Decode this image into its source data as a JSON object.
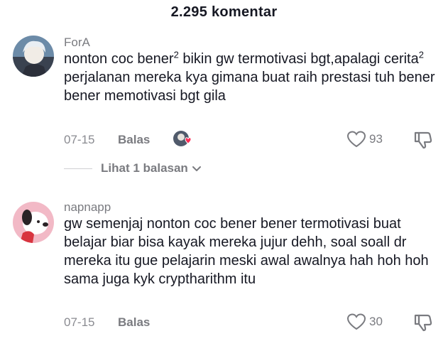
{
  "header": {
    "title": "2.295 komentar"
  },
  "comments": [
    {
      "username": "ForA",
      "text_parts": [
        "nonton coc bener",
        "2",
        " bikin gw termotivasi bgt,apalagi cerita",
        "2",
        " perjalanan mereka kya gimana buat raih prestasi tuh bener bener memotivasi bgt gila"
      ],
      "date": "07-15",
      "reply_label": "Balas",
      "likes": "93",
      "view_replies": "Lihat 1 balasan"
    },
    {
      "username": "napnapp",
      "text": "gw semenjaj nonton coc bener bener termotivasi buat belajar biar bisa kayak mereka jujur dehh, soal soall dr mereka itu gue pelajarin meski awal awalnya hah hoh hoh sama juga kyk cryptharithm itu",
      "date": "07-15",
      "reply_label": "Balas",
      "likes": "30"
    }
  ],
  "colors": {
    "text_primary": "#161823",
    "text_secondary": "#7a7b80",
    "creator_heart": "#fe2c55"
  },
  "icons": [
    "heart-outline-icon",
    "thumbs-down-icon",
    "chevron-down-icon",
    "creator-liked-heart-icon"
  ]
}
